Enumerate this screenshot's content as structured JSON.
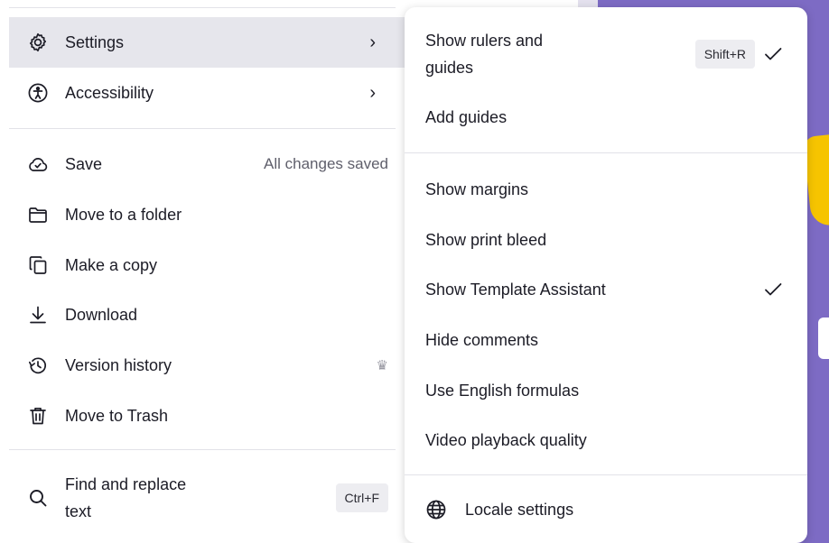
{
  "main_menu": {
    "settings_label": "Settings",
    "accessibility_label": "Accessibility",
    "save_label": "Save",
    "save_status": "All changes saved",
    "move_folder_label": "Move to a folder",
    "make_copy_label": "Make a copy",
    "download_label": "Download",
    "version_history_label": "Version history",
    "version_history_badge": "♛",
    "move_trash_label": "Move to Trash",
    "find_replace_label_line1": "Find and replace",
    "find_replace_label_line2": "text",
    "find_replace_shortcut": "Ctrl+F",
    "chevron": "›"
  },
  "settings_submenu": {
    "rulers_label_line1": "Show rulers and",
    "rulers_label_line2": "guides",
    "rulers_shortcut": "Shift+R",
    "rulers_checked": true,
    "add_guides_label": "Add guides",
    "margins_label": "Show margins",
    "print_bleed_label": "Show print bleed",
    "template_assistant_label": "Show Template Assistant",
    "template_assistant_checked": true,
    "hide_comments_label": "Hide comments",
    "english_formulas_label": "Use English formulas",
    "video_quality_label": "Video playback quality",
    "locale_label": "Locale settings"
  },
  "icons": {
    "settings": "gear-icon",
    "accessibility": "accessibility-icon",
    "save": "cloud-check-icon",
    "folder": "folder-icon",
    "copy": "copy-icon",
    "download": "download-icon",
    "history": "history-icon",
    "trash": "trash-icon",
    "search": "search-icon",
    "check": "checkmark-icon",
    "globe": "globe-icon",
    "crown": "crown-icon"
  },
  "colors": {
    "canvas_purple": "#7d6bc4",
    "accent_yellow": "#f6c400",
    "hover_bg": "#e6e6ec"
  }
}
